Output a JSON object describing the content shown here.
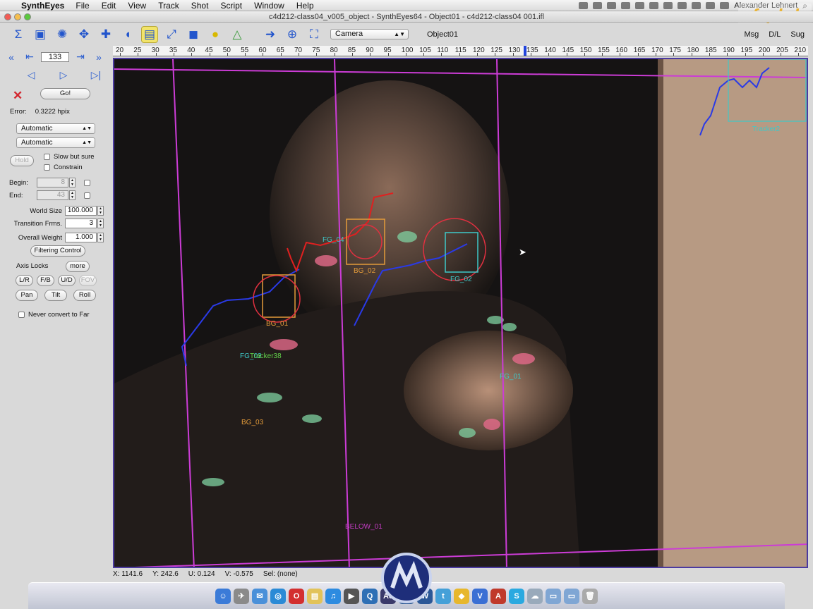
{
  "menubar": {
    "app_name": "SynthEyes",
    "items": [
      "File",
      "Edit",
      "View",
      "Track",
      "Shot",
      "Script",
      "Window",
      "Help"
    ],
    "user": "Alexander Lehnert"
  },
  "window": {
    "title": "c4d212-class04_v005_object - SynthEyes64 - Object01 - c4d212-class04 001.ifl"
  },
  "toolbar": {
    "camera_select": "Camera",
    "object_label": "Object01",
    "right_buttons": [
      "Msg",
      "D/L",
      "Sug"
    ]
  },
  "timeline": {
    "current_frame": "133",
    "ticks": [
      "20",
      "25",
      "30",
      "35",
      "40",
      "45",
      "50",
      "55",
      "60",
      "65",
      "70",
      "75",
      "80",
      "85",
      "90",
      "95",
      "100",
      "105",
      "110",
      "115",
      "120",
      "125",
      "130",
      "135",
      "140",
      "145",
      "150",
      "155",
      "160",
      "165",
      "170",
      "175",
      "180",
      "185",
      "190",
      "195",
      "200",
      "205",
      "210"
    ]
  },
  "panel": {
    "go_label": "Go!",
    "error_label": "Error:",
    "error_value": "0.3222 hpix",
    "dropdown1": "Automatic",
    "dropdown2": "Automatic",
    "hold_label": "Hold",
    "slow_but_sure": "Slow but sure",
    "constrain": "Constrain",
    "begin_label": "Begin:",
    "begin_value": "8",
    "end_label": "End:",
    "end_value": "43",
    "world_size_label": "World Size",
    "world_size_value": "100.000",
    "transition_label": "Transition Frms.",
    "transition_value": "3",
    "overall_weight_label": "Overall Weight",
    "overall_weight_value": "1.000",
    "filtering_control": "Filtering Control",
    "axis_locks": "Axis Locks",
    "more": "more",
    "lock_buttons": [
      "L/R",
      "F/B",
      "U/D",
      "FOV"
    ],
    "rot_buttons": [
      "Pan",
      "Tilt",
      "Roll"
    ],
    "never_convert": "Never convert to Far"
  },
  "trackers": [
    {
      "name": "BG_01",
      "color": "#e39b3a"
    },
    {
      "name": "BG_02",
      "color": "#e39b3a"
    },
    {
      "name": "BG_03",
      "color": "#e39b3a"
    },
    {
      "name": "FG_02",
      "color": "#3ec9c9"
    },
    {
      "name": "FG_01",
      "color": "#3ec9c9"
    },
    {
      "name": "FG_04",
      "color": "#3ec9c9"
    },
    {
      "name": "FG_03",
      "color": "#3ec9c9"
    },
    {
      "name": "Tracker38",
      "color": "#62d14a"
    },
    {
      "name": "Tracker2",
      "color": "#3ec9c9"
    },
    {
      "name": "BELOW_01",
      "color": "#c43cc4"
    }
  ],
  "statusbar": {
    "x_label": "X:",
    "x_value": "1141.6",
    "y_label": "Y:",
    "y_value": "242.6",
    "u_label": "U:",
    "u_value": "0.124",
    "v_label": "V:",
    "v_value": "-0.575",
    "sel_label": "Sel:",
    "sel_value": "(none)"
  },
  "watermark": "fxphd",
  "dock_apps": [
    "Finder",
    "Safari",
    "Mail",
    "Opera",
    "Notes",
    "iTunes",
    "Terminal",
    "Preview",
    "Ae",
    "Ps",
    "Word",
    "Twitter",
    "Skype"
  ]
}
